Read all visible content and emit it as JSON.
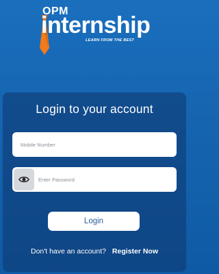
{
  "logo": {
    "prefix": "OPM",
    "name": "internship",
    "tagline": "LEARN FROM THE BEST",
    "tie_color": "#f07a1c"
  },
  "login": {
    "title": "Login to your account",
    "mobile_placeholder": "Mobile Number",
    "password_placeholder": "Enter Password",
    "password_toggle_icon": "eye-icon",
    "submit_label": "Login",
    "signup_prompt": "Don't have an account?",
    "signup_link": "Register Now"
  },
  "colors": {
    "background": "#1665b1",
    "card": "#0f376e",
    "button_text": "#2a5d99"
  }
}
